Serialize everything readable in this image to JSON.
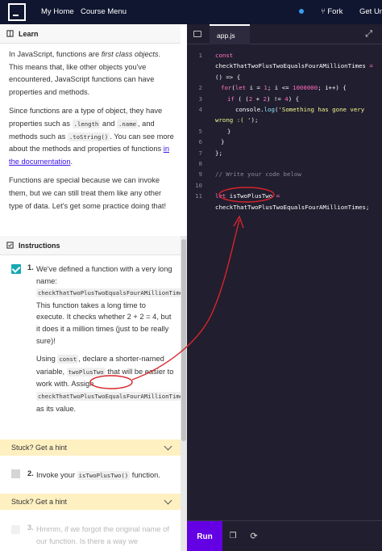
{
  "nav": {
    "my_home": "My Home",
    "course_menu": "Course Menu",
    "fork": "Fork",
    "get_unstuck": "Get Uns"
  },
  "learn": {
    "title": "Learn",
    "p1_a": "In JavaScript, functions are ",
    "p1_em": "first class objects",
    "p1_b": ". This means that, like other objects you've encountered, JavaScript functions can have properties and methods.",
    "p2_a": "Since functions are a type of object, they have properties such as ",
    "p2_code1": ".length",
    "p2_b": " and ",
    "p2_code2": ".name",
    "p2_c": ", and methods such as ",
    "p2_code3": ".toString()",
    "p2_d": ". You can see more about the methods and properties of functions ",
    "p2_link": "in the documentation",
    "p2_e": ".",
    "p3": "Functions are special because we can invoke them, but we can still treat them like any other type of data. Let's get some practice doing that!"
  },
  "instructions": {
    "title": "Instructions",
    "task1": {
      "number": "1.",
      "p1_a": "We've defined a function with a very long name: ",
      "p1_code": "checkThatTwoPlusTwoEqualsFourAMillionTimes",
      "p1_b": ". This function takes a long time to execute. It checks whether 2 + 2 = 4, but it does it a million times (just to be really sure)!",
      "p2_a": "Using ",
      "p2_code1": "const",
      "p2_b": ", declare a shorter-named variable, ",
      "p2_code2": "twoPlusTwo",
      "p2_c": " that will be easier to work with. Assign ",
      "p2_code3": "checkThatTwoPlusTwoEqualsFourAMillionTimes",
      "p2_d": " as its value."
    },
    "hint1": "Stuck? Get a hint",
    "task2": {
      "number": "2.",
      "text_a": "Invoke your ",
      "code": "isTwoPlusTwo()",
      "text_b": " function."
    },
    "hint2": "Stuck? Get a hint",
    "task3": {
      "number": "3.",
      "text": "Hmmm, if we forgot the original name of our function. Is there a way we"
    }
  },
  "editor": {
    "file_tab": "app.js",
    "lines": {
      "n1": "1",
      "n2": "2",
      "n3": "3",
      "n4": "4",
      "n5": "5",
      "n6": "6",
      "n7": "7",
      "n8": "8",
      "n9": "9",
      "n10": "10",
      "n11": "11",
      "l1_kw": "const",
      "l1_name": "checkThatTwoPlusTwoEqualsFourAMillionTimes",
      "l1_eq": " =",
      "l1b": "() => {",
      "l2_a": "for",
      "l2_b": "(",
      "l2_let": "let",
      "l2_c": " i = ",
      "l2_one": "1",
      "l2_d": "; i <= ",
      "l2_mil": "1000000",
      "l2_e": "; i++) {",
      "l3_if": "if",
      "l3_a": " ( (",
      "l3_two1": "2",
      "l3_b": " + ",
      "l3_two2": "2",
      "l3_c": ") != ",
      "l3_four": "4",
      "l3_d": ") {",
      "l4_a": "console.",
      "l4_fn": "log",
      "l4_b": "(",
      "l4_str": "'Something has gone very",
      "l4c_str": "wrong :( '",
      "l4c_b": ");",
      "l5": "}",
      "l6": "}",
      "l7": "};",
      "l9": "// Write your code below",
      "l11_let": "let",
      "l11_name": " isTwoPlusTwo",
      "l11_eq": " =",
      "l11b": "checkThatTwoPlusTwoEqualsFourAMillionTimes;"
    },
    "run": "Run"
  },
  "colors": {
    "nav_bg": "#10162f",
    "editor_bg": "#211e2f",
    "run_button": "#6400e4",
    "hint_bg": "#fff0c2",
    "check": "#16a8b5",
    "annotation": "#d8252b"
  }
}
